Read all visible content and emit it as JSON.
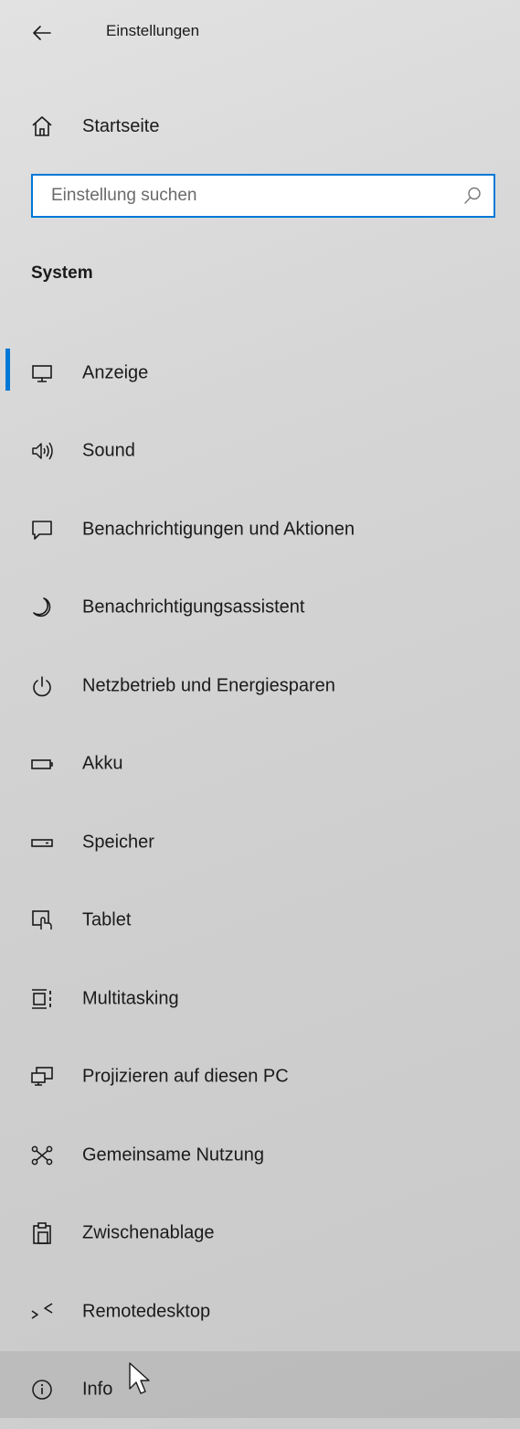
{
  "window": {
    "title": "Einstellungen"
  },
  "nav": {
    "home_label": "Startseite"
  },
  "search": {
    "placeholder": "Einstellung suchen",
    "value": ""
  },
  "section": {
    "title": "System"
  },
  "items": [
    {
      "label": "Anzeige",
      "icon": "monitor-icon",
      "selected": true
    },
    {
      "label": "Sound",
      "icon": "speaker-icon"
    },
    {
      "label": "Benachrichtigungen und Aktionen",
      "icon": "notification-icon"
    },
    {
      "label": "Benachrichtigungsassistent",
      "icon": "moon-icon"
    },
    {
      "label": "Netzbetrieb und Energiesparen",
      "icon": "power-icon"
    },
    {
      "label": "Akku",
      "icon": "battery-icon"
    },
    {
      "label": "Speicher",
      "icon": "storage-icon"
    },
    {
      "label": "Tablet",
      "icon": "tablet-icon"
    },
    {
      "label": "Multitasking",
      "icon": "multitasking-icon"
    },
    {
      "label": "Projizieren auf diesen PC",
      "icon": "project-icon"
    },
    {
      "label": "Gemeinsame Nutzung",
      "icon": "share-icon"
    },
    {
      "label": "Zwischenablage",
      "icon": "clipboard-icon"
    },
    {
      "label": "Remotedesktop",
      "icon": "remote-desktop-icon"
    },
    {
      "label": "Info",
      "icon": "info-icon",
      "hovered": true
    }
  ],
  "colors": {
    "accent": "#0078d7",
    "text": "#1a1a1a"
  }
}
